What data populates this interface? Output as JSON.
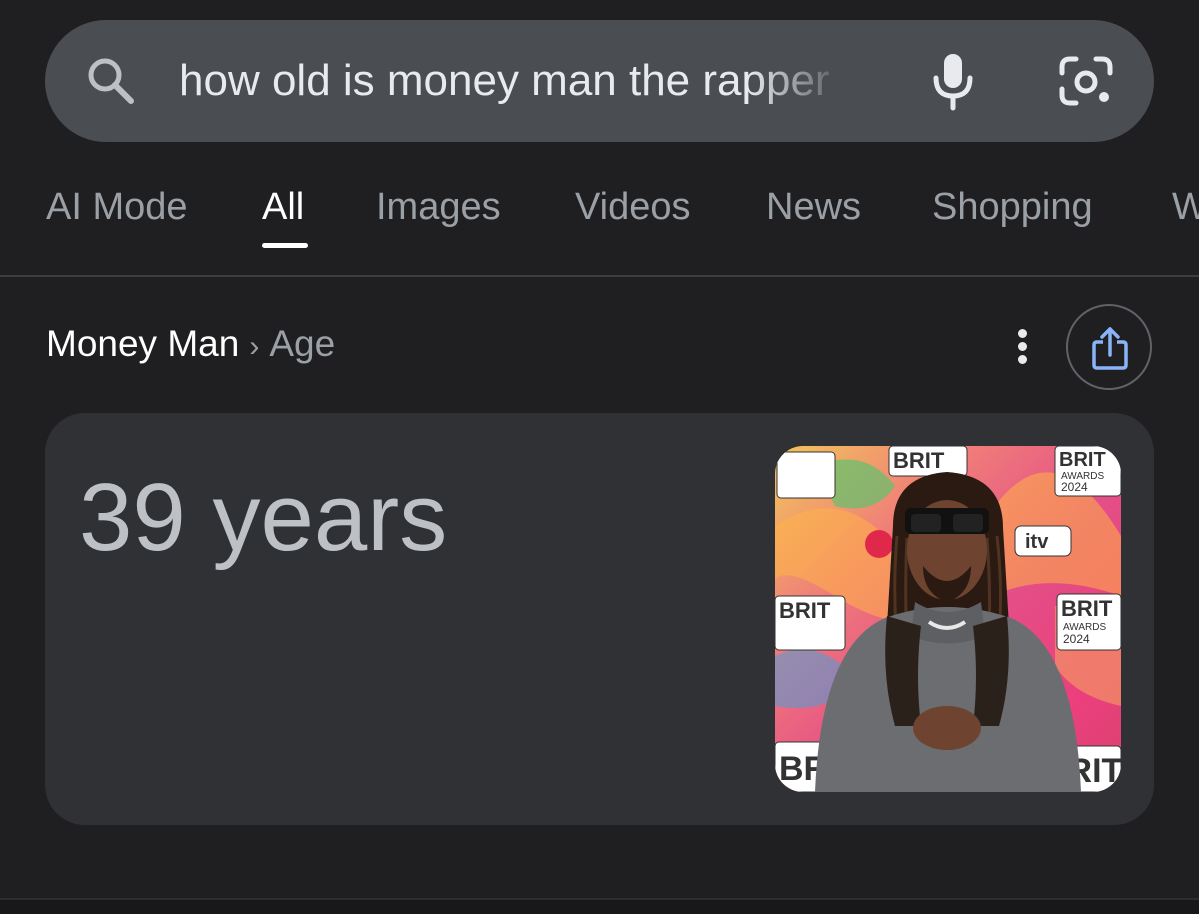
{
  "search": {
    "query": "how old is money man the rapper",
    "search_icon": "search-icon",
    "mic_icon": "microphone-icon",
    "lens_icon": "google-lens-icon"
  },
  "tabs": [
    {
      "label": "AI Mode",
      "active": false
    },
    {
      "label": "All",
      "active": true
    },
    {
      "label": "Images",
      "active": false
    },
    {
      "label": "Videos",
      "active": false
    },
    {
      "label": "News",
      "active": false
    },
    {
      "label": "Shopping",
      "active": false
    },
    {
      "label": "W",
      "active": false
    }
  ],
  "breadcrumb": {
    "entity": "Money Man",
    "separator": "›",
    "attribute": "Age"
  },
  "actions": {
    "more_icon": "more-vert-icon",
    "share_icon": "share-icon"
  },
  "answer": {
    "value": "39 years"
  },
  "photo": {
    "backdrop_brand": "BRIT",
    "backdrop_sub": "AWARDS",
    "backdrop_year": "2024",
    "backdrop_logo": "itv"
  },
  "colors": {
    "background": "#1f1f21",
    "search_bar": "#4a4d52",
    "card": "#303134",
    "share_accent": "#8ab4f8"
  }
}
